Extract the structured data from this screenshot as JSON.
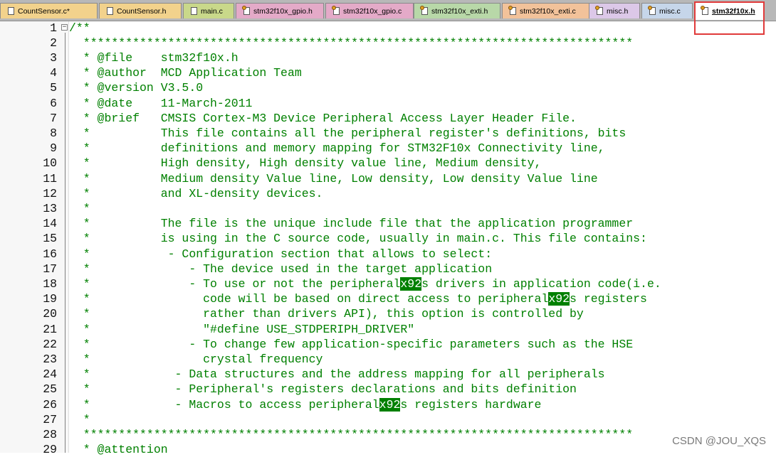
{
  "tabs": [
    {
      "label": "CountSensor.c*",
      "icon": "file-icon",
      "color": "#f2d28c"
    },
    {
      "label": "CountSensor.h",
      "icon": "file-icon",
      "color": "#f2d28c"
    },
    {
      "label": "main.c",
      "icon": "file-icon",
      "color": "#c9d88a"
    },
    {
      "label": "stm32f10x_gpio.h",
      "icon": "file-gear-icon",
      "color": "#e4aac8"
    },
    {
      "label": "stm32f10x_gpio.c",
      "icon": "file-gear-icon",
      "color": "#e4aac8"
    },
    {
      "label": "stm32f10x_exti.h",
      "icon": "file-gear-icon",
      "color": "#b8d8a8"
    },
    {
      "label": "stm32f10x_exti.c",
      "icon": "file-gear-icon",
      "color": "#f2c29a"
    },
    {
      "label": "misc.h",
      "icon": "file-gear-icon",
      "color": "#dcc8e8"
    },
    {
      "label": "misc.c",
      "icon": "file-gear-icon",
      "color": "#c6d6ea"
    },
    {
      "label": "stm32f10x.h",
      "icon": "file-gear-icon",
      "color": "#ffffff",
      "active": true
    }
  ],
  "colors": {
    "comment": "#008000",
    "highlight_bg": "#008000",
    "highlight_box": "#e03a3a"
  },
  "lines": [
    {
      "n": "1",
      "segs": [
        "/**"
      ]
    },
    {
      "n": "2",
      "segs": [
        "  ******************************************************************************"
      ]
    },
    {
      "n": "3",
      "segs": [
        "  * @file    stm32f10x.h"
      ]
    },
    {
      "n": "4",
      "segs": [
        "  * @author  MCD Application Team"
      ]
    },
    {
      "n": "5",
      "segs": [
        "  * @version V3.5.0"
      ]
    },
    {
      "n": "6",
      "segs": [
        "  * @date    11-March-2011"
      ]
    },
    {
      "n": "7",
      "segs": [
        "  * @brief   CMSIS Cortex-M3 Device Peripheral Access Layer Header File."
      ]
    },
    {
      "n": "8",
      "segs": [
        "  *          This file contains all the peripheral register's definitions, bits"
      ]
    },
    {
      "n": "9",
      "segs": [
        "  *          definitions and memory mapping for STM32F10x Connectivity line,"
      ]
    },
    {
      "n": "10",
      "segs": [
        "  *          High density, High density value line, Medium density,"
      ]
    },
    {
      "n": "11",
      "segs": [
        "  *          Medium density Value line, Low density, Low density Value line"
      ]
    },
    {
      "n": "12",
      "segs": [
        "  *          and XL-density devices."
      ]
    },
    {
      "n": "13",
      "segs": [
        "  *"
      ]
    },
    {
      "n": "14",
      "segs": [
        "  *          The file is the unique include file that the application programmer"
      ]
    },
    {
      "n": "15",
      "segs": [
        "  *          is using in the C source code, usually in main.c. This file contains:"
      ]
    },
    {
      "n": "16",
      "segs": [
        "  *           - Configuration section that allows to select:"
      ]
    },
    {
      "n": "17",
      "segs": [
        "  *              - The device used in the target application"
      ]
    },
    {
      "n": "18",
      "segs": [
        "  *              - To use or not the peripheral",
        {
          "hl": "x92"
        },
        "s drivers in application code(i.e."
      ]
    },
    {
      "n": "19",
      "segs": [
        "  *                code will be based on direct access to peripheral",
        {
          "hl": "x92"
        },
        "s registers"
      ]
    },
    {
      "n": "20",
      "segs": [
        "  *                rather than drivers API), this option is controlled by"
      ]
    },
    {
      "n": "21",
      "segs": [
        "  *                \"#define USE_STDPERIPH_DRIVER\""
      ]
    },
    {
      "n": "22",
      "segs": [
        "  *              - To change few application-specific parameters such as the HSE"
      ]
    },
    {
      "n": "23",
      "segs": [
        "  *                crystal frequency"
      ]
    },
    {
      "n": "24",
      "segs": [
        "  *            - Data structures and the address mapping for all peripherals"
      ]
    },
    {
      "n": "25",
      "segs": [
        "  *            - Peripheral's registers declarations and bits definition"
      ]
    },
    {
      "n": "26",
      "segs": [
        "  *            - Macros to access peripheral",
        {
          "hl": "x92"
        },
        "s registers hardware"
      ]
    },
    {
      "n": "27",
      "segs": [
        "  *"
      ]
    },
    {
      "n": "28",
      "segs": [
        "  ******************************************************************************"
      ]
    },
    {
      "n": "29",
      "segs": [
        "  * @attention"
      ]
    }
  ],
  "watermark": "CSDN @JOU_XQS"
}
